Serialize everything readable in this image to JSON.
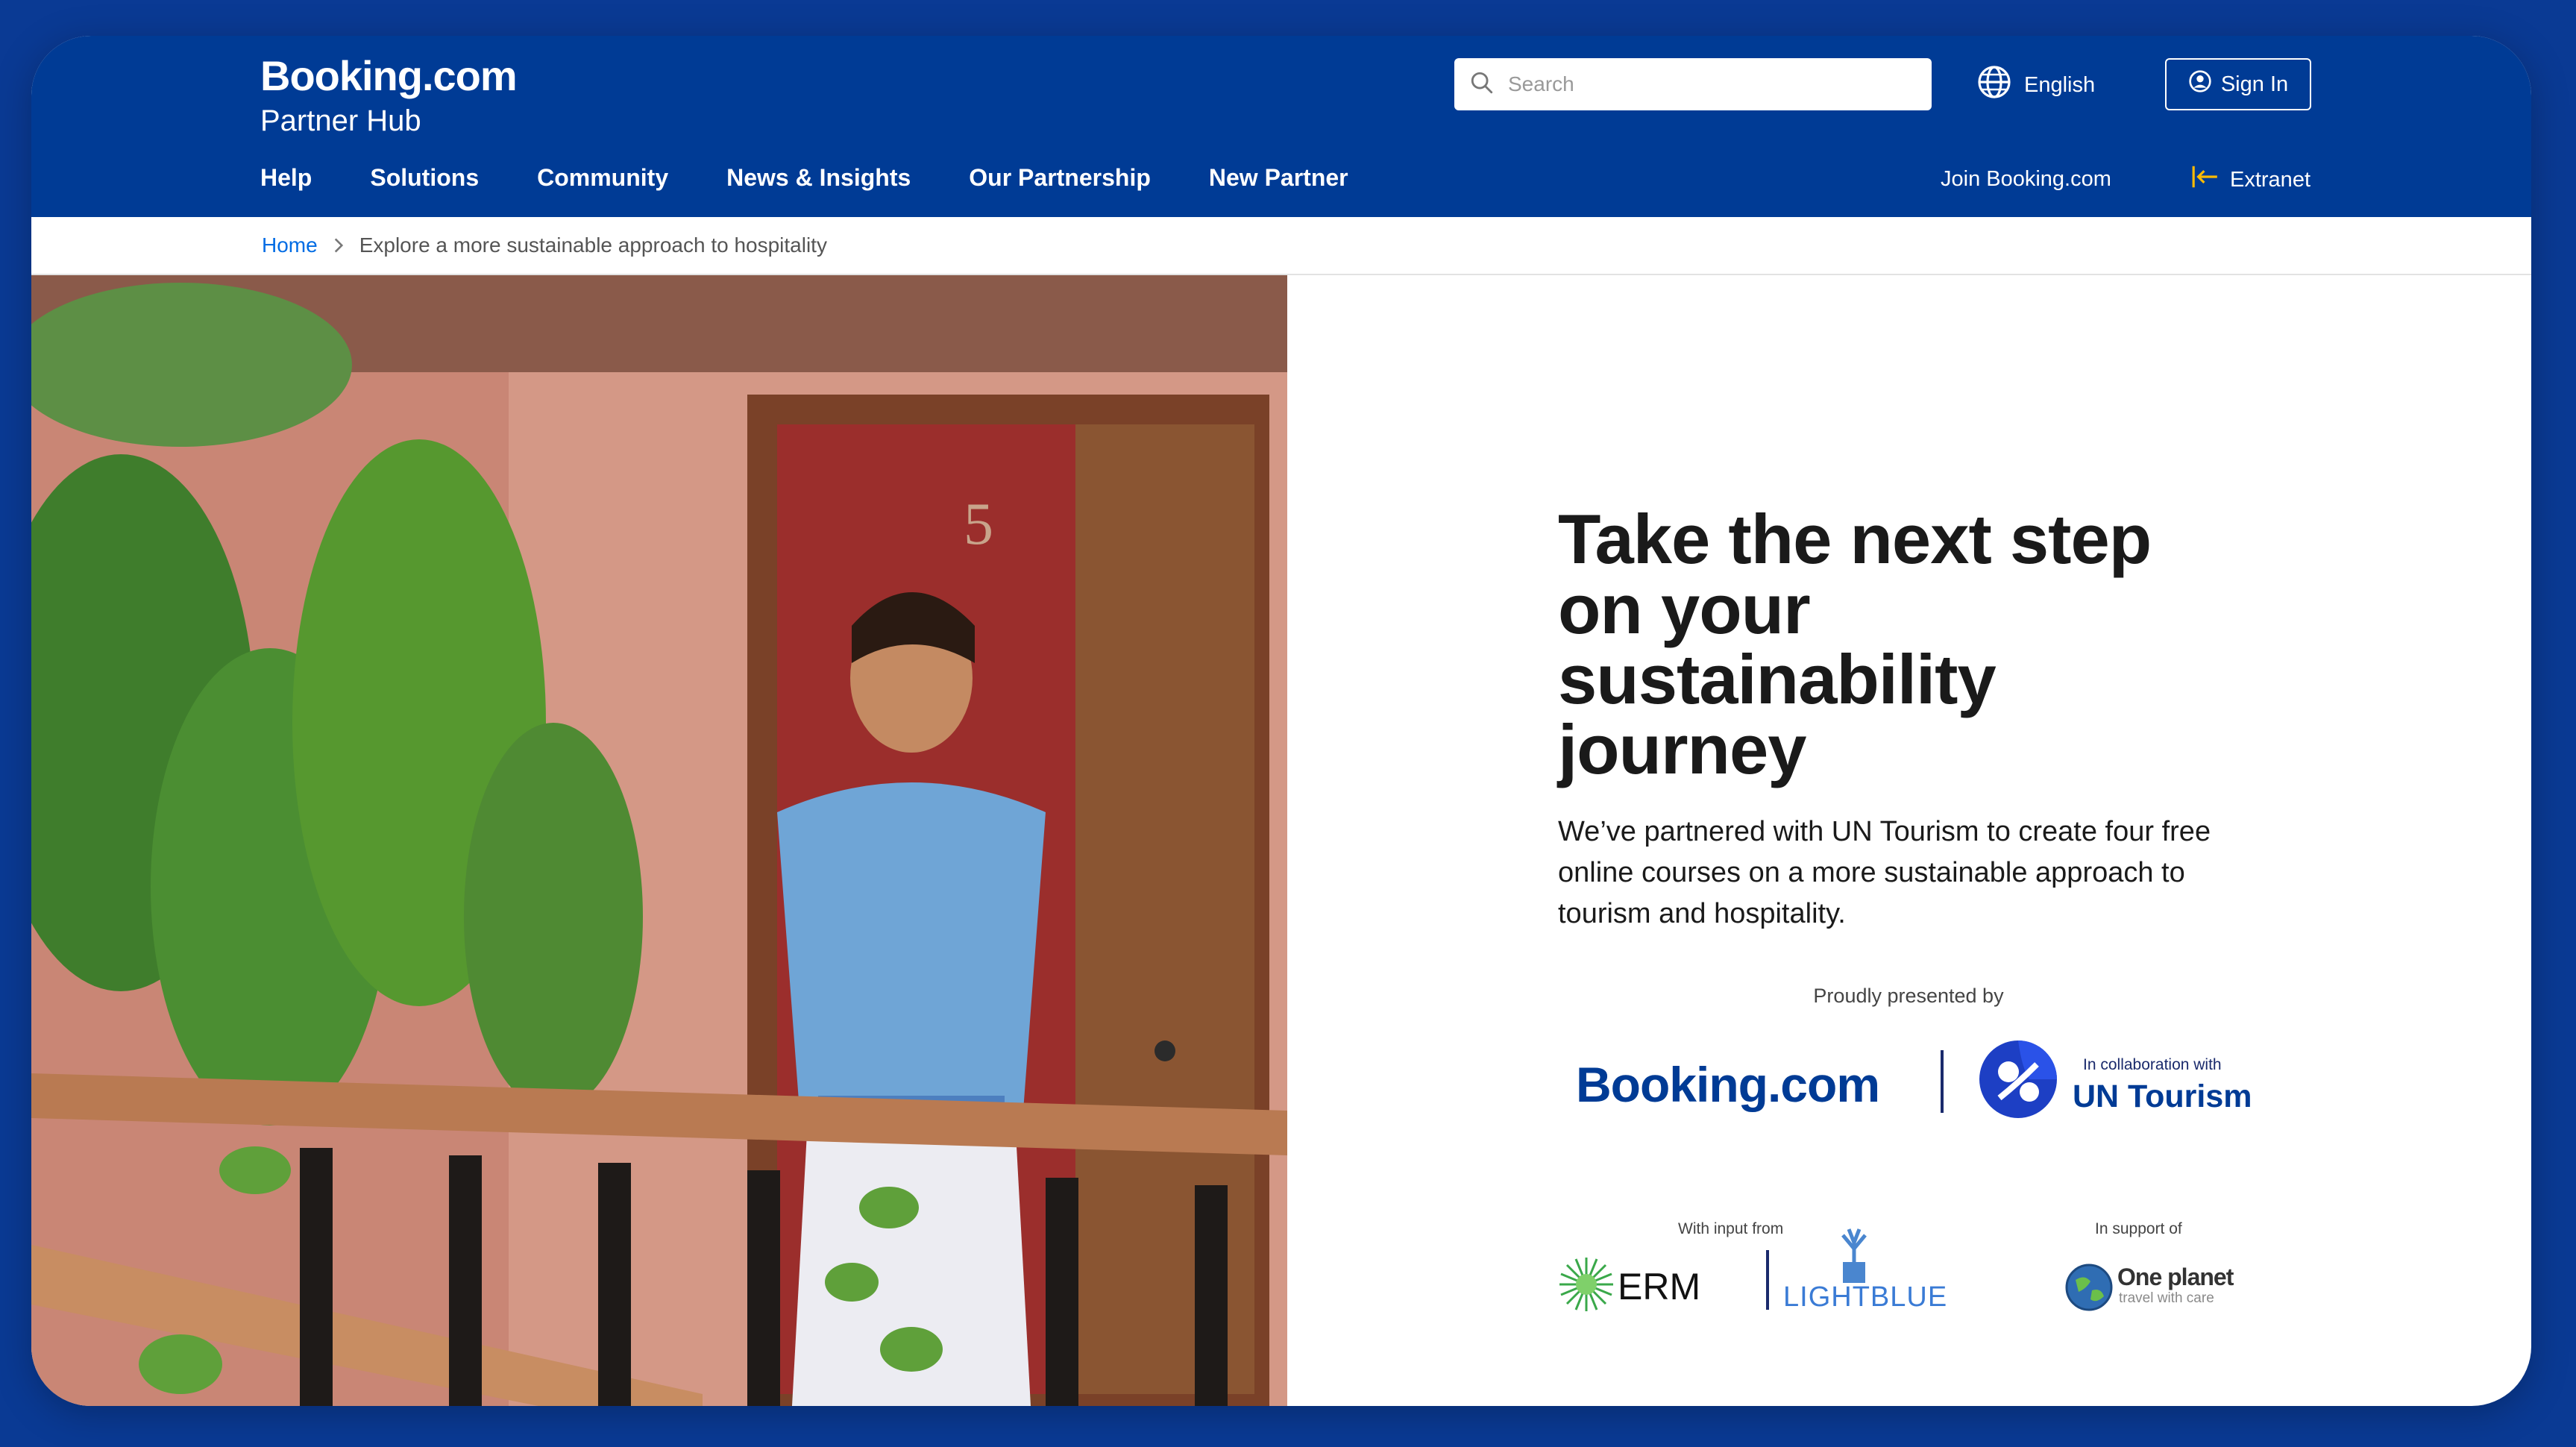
{
  "header": {
    "logo_main": "Booking.com",
    "logo_sub": "Partner Hub",
    "search_placeholder": "Search",
    "language": "English",
    "sign_in": "Sign In",
    "nav": [
      "Help",
      "Solutions",
      "Community",
      "News & Insights",
      "Our Partnership",
      "New Partner"
    ],
    "join_label": "Join Booking.com",
    "extranet_label": "Extranet"
  },
  "breadcrumb": {
    "home": "Home",
    "current": "Explore a more sustainable approach to hospitality"
  },
  "hero": {
    "door_number": "5",
    "headline": "Take the next step on your sustainability journey",
    "description": "We’ve partnered with UN Tourism to create four free online courses on a more sustainable approach to tourism and hospitality."
  },
  "partners": {
    "presented_by": "Proudly presented by",
    "booking_logo": "Booking.com",
    "un_collab": "In collaboration with",
    "un_name": "UN Tourism",
    "with_input_from": "With input from",
    "erm": "ERM",
    "lightblue": "LIGHTBLUE",
    "in_support_of": "In support of",
    "oneplanet_name": "One planet",
    "oneplanet_tag": "travel with care"
  },
  "colors": {
    "brand_blue": "#003b95",
    "page_bg": "#0a3a94",
    "link_blue": "#006ce4",
    "extranet_arrow": "#febb02"
  },
  "icons": {
    "search": "search-icon",
    "globe": "globe-icon",
    "user": "user-icon",
    "extranet": "extranet-arrow-icon",
    "breadcrumb_sep": "chevron-right-icon"
  }
}
